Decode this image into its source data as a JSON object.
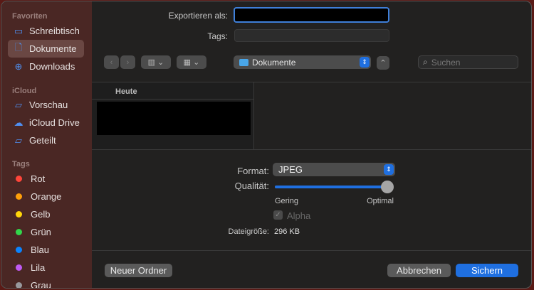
{
  "sidebar": {
    "favorites_header": "Favoriten",
    "favorites": [
      {
        "label": "Schreibtisch",
        "icon": "desktop-icon"
      },
      {
        "label": "Dokumente",
        "icon": "document-icon",
        "selected": true
      },
      {
        "label": "Downloads",
        "icon": "download-icon"
      }
    ],
    "icloud_header": "iCloud",
    "icloud": [
      {
        "label": "Vorschau",
        "icon": "folder-icon"
      },
      {
        "label": "iCloud Drive",
        "icon": "cloud-icon"
      },
      {
        "label": "Geteilt",
        "icon": "shared-folder-icon"
      }
    ],
    "tags_header": "Tags",
    "tags": [
      {
        "label": "Rot",
        "color": "#ff453a"
      },
      {
        "label": "Orange",
        "color": "#ff9f0a"
      },
      {
        "label": "Gelb",
        "color": "#ffd60a"
      },
      {
        "label": "Grün",
        "color": "#32d74b"
      },
      {
        "label": "Blau",
        "color": "#0a84ff"
      },
      {
        "label": "Lila",
        "color": "#bf5af2"
      },
      {
        "label": "Grau",
        "color": "#98989d"
      }
    ]
  },
  "export": {
    "label": "Exportieren als:",
    "value": "",
    "tags_label": "Tags:",
    "tags_value": ""
  },
  "toolbar": {
    "location": "Dokumente",
    "search_placeholder": "Suchen"
  },
  "browser": {
    "column_header": "Heute"
  },
  "options": {
    "format_label": "Format:",
    "format_value": "JPEG",
    "quality_label": "Qualität:",
    "quality_value": 1.0,
    "quality_min": "Gering",
    "quality_max": "Optimal",
    "alpha_label": "Alpha",
    "alpha_checked": true,
    "filesize_label": "Dateigröße:",
    "filesize_value": "296 KB"
  },
  "buttons": {
    "new_folder": "Neuer Ordner",
    "cancel": "Abbrechen",
    "save": "Sichern"
  },
  "accent": "#1f6fe0"
}
